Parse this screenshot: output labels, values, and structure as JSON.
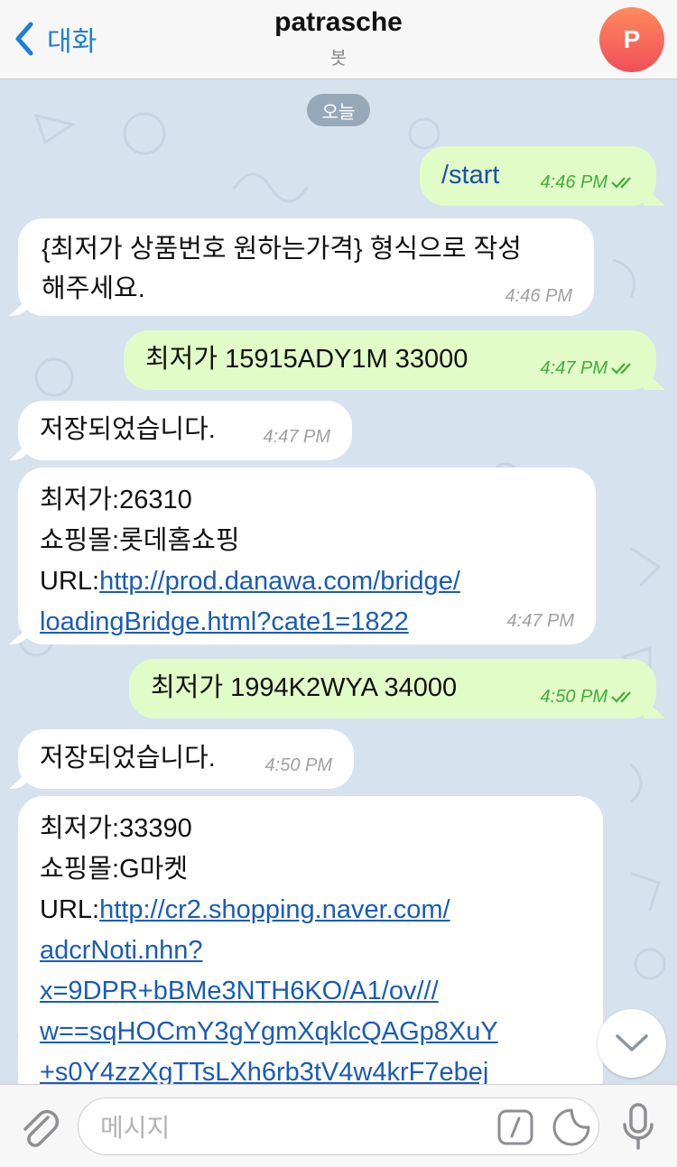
{
  "header": {
    "back_label": "대화",
    "title": "patrasche",
    "subtitle": "봇",
    "avatar_letter": "P",
    "avatar_gradient": [
      "#ff8a5c",
      "#f04e5a"
    ]
  },
  "chat": {
    "date_chip": "오늘",
    "messages": [
      {
        "dir": "out",
        "text": "/start",
        "time": "4:46 PM"
      },
      {
        "dir": "in",
        "line1": "{최저가 상품번호 원하는가격} 형식으로 작성",
        "line2": "해주세요.",
        "time": "4:46 PM"
      },
      {
        "dir": "out",
        "text": "최저가 15915ADY1M 33000",
        "time": "4:47 PM"
      },
      {
        "dir": "in",
        "text": "저장되었습니다.",
        "time": "4:47 PM"
      },
      {
        "dir": "in",
        "price": "최저가:26310",
        "mall": "쇼핑몰:롯데홈쇼핑",
        "url_prefix": "URL:",
        "url_line1": "http://prod.danawa.com/bridge/",
        "url_line2": "loadingBridge.html?cate1=1822",
        "time": "4:47 PM"
      },
      {
        "dir": "out",
        "text": "최저가 1994K2WYA 34000",
        "time": "4:50 PM"
      },
      {
        "dir": "in",
        "text": "저장되었습니다.",
        "time": "4:50 PM"
      },
      {
        "dir": "in",
        "price": "최저가:33390",
        "mall": "쇼핑몰:G마켓",
        "url_prefix": "URL:",
        "url_line1": "http://cr2.shopping.naver.com/",
        "url_line2": "adcrNoti.nhn?",
        "url_line3": "x=9DPR+bBMe3NTH6KO/A1/ov///",
        "url_line4": "w==sqHOCmY3gYgmXqklcQAGp8XuY",
        "url_line5": "+s0Y4zzXgTTsLXh6rb3tV4w4krF7ebej"
      }
    ]
  },
  "input": {
    "placeholder": "메시지"
  },
  "colors": {
    "accent": "#1a7fd9",
    "outgoing_bubble": "#e2fcc7",
    "incoming_bubble": "#ffffff",
    "chat_bg": "#d6e2ee",
    "link": "#1a5bb8",
    "read_ticks": "#3fae3a"
  }
}
